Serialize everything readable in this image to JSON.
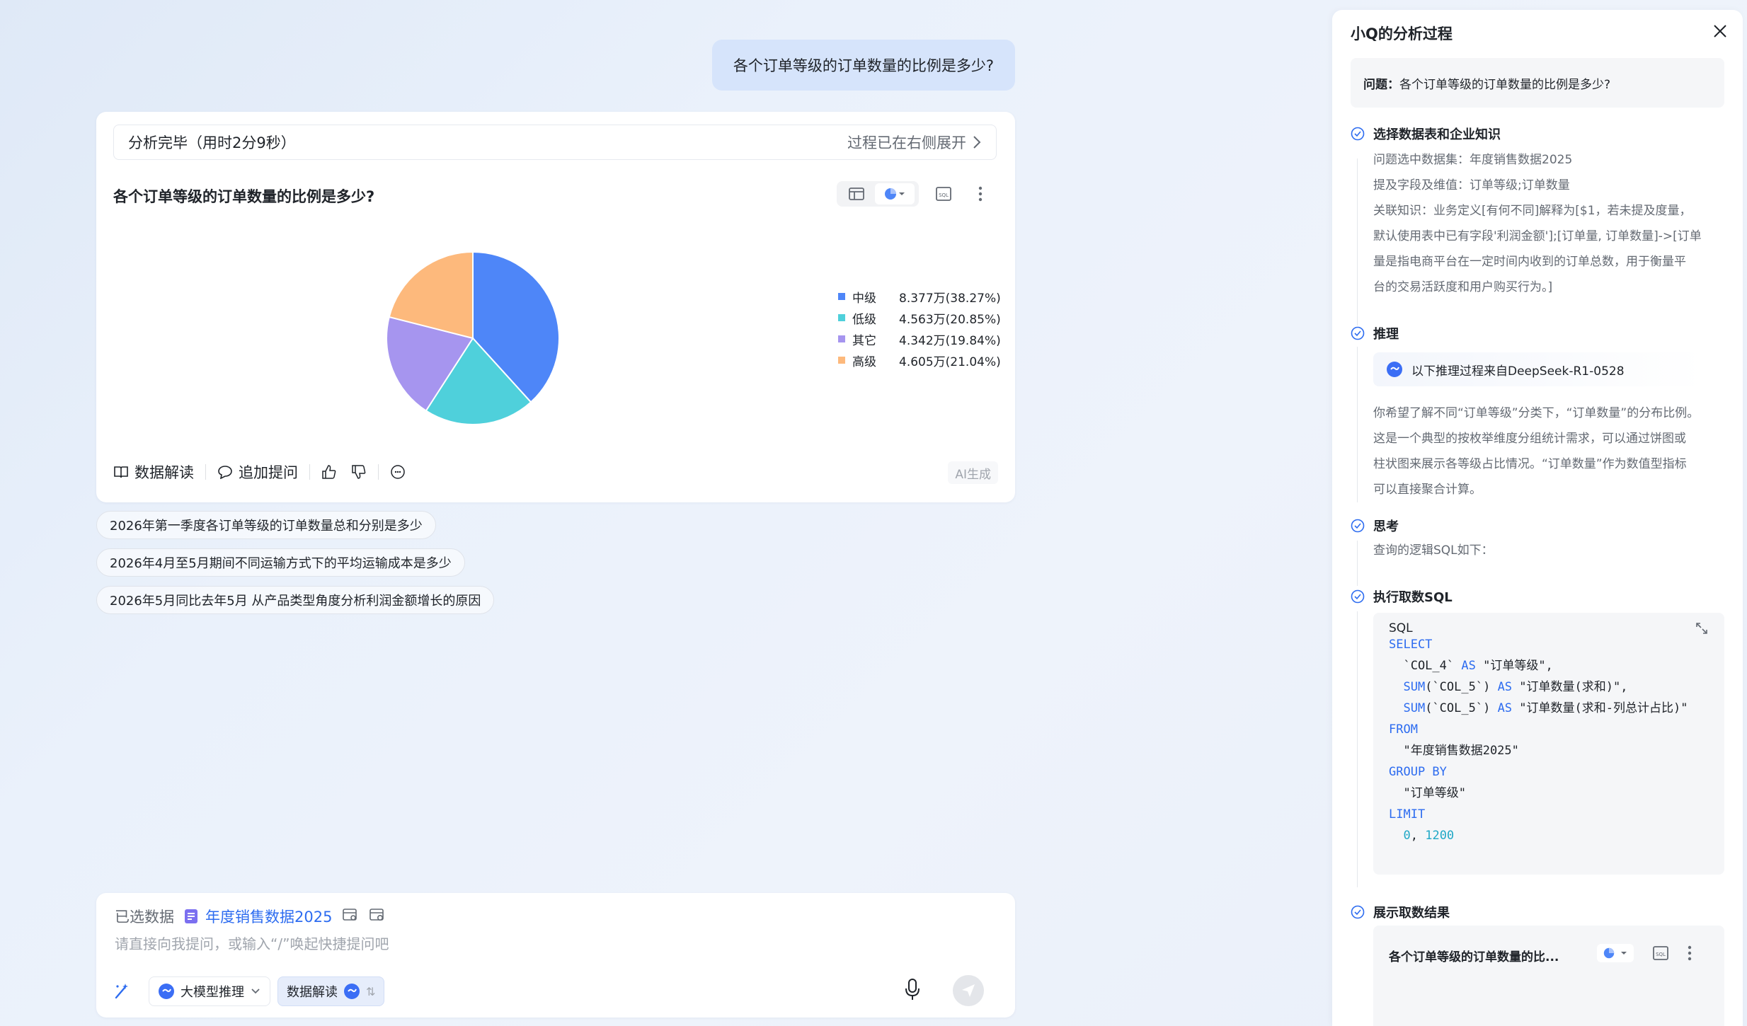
{
  "chat": {
    "user_question": "各个订单等级的订单数量的比例是多少?",
    "status_text": "分析完毕（用时2分9秒）",
    "process_hint": "过程已在右侧展开",
    "answer_title": "各个订单等级的订单数量的比例是多少?",
    "actions": {
      "interpret": "数据解读",
      "followup": "追加提问"
    },
    "ai_tag": "AI生成",
    "suggestions": [
      "2026年第一季度各订单等级的订单数量总和分别是多少",
      "2026年4月至5月期间不同运输方式下的平均运输成本是多少",
      "2026年5月同比去年5月 从产品类型角度分析利润金额增长的原因"
    ]
  },
  "chart_data": {
    "type": "pie",
    "slices": [
      {
        "name": "中级",
        "value": 8.377,
        "label": "8.377万(38.27%)",
        "percent": 38.27,
        "color": "#4e86f8"
      },
      {
        "name": "低级",
        "value": 4.563,
        "label": "4.563万(20.85%)",
        "percent": 20.85,
        "color": "#4fd0db"
      },
      {
        "name": "其它",
        "value": 4.342,
        "label": "4.342万(19.84%)",
        "percent": 19.84,
        "color": "#a695ef"
      },
      {
        "name": "高级",
        "value": 4.605,
        "label": "4.605万(21.04%)",
        "percent": 21.04,
        "color": "#fdb97c"
      }
    ],
    "legend_position": "right"
  },
  "input": {
    "selected_label": "已选数据",
    "dataset_name": "年度销售数据2025",
    "placeholder": "请直接向我提问，或输入“/”唤起快捷提问吧",
    "model_label": "大模型推理",
    "mode_label": "数据解读",
    "mode_suffix": "⇅"
  },
  "panel": {
    "title": "小Q的分析过程",
    "question_prefix": "问题：",
    "question": "各个订单等级的订单数量的比例是多少?",
    "steps": {
      "select": {
        "title": "选择数据表和企业知识",
        "lines": [
          "问题选中数据集：年度销售数据2025",
          "提及字段及维值：订单等级;订单数量",
          "关联知识：业务定义[有何不同]解释为[$1，若未提及度量，",
          "默认使用表中已有字段'利润金额'];[订单量, 订单数量]->[订单",
          "量是指电商平台在一定时间内收到的订单总数，用于衡量平",
          "台的交易活跃度和用户购买行为。]"
        ]
      },
      "reason": {
        "title": "推理",
        "source": "以下推理过程来自DeepSeek-R1-0528",
        "lines": [
          "你希望了解不同“订单等级”分类下，“订单数量”的分布比例。",
          "这是一个典型的按枚举维度分组统计需求，可以通过饼图或",
          "柱状图来展示各等级占比情况。“订单数量”作为数值型指标",
          "可以直接聚合计算。"
        ]
      },
      "think": {
        "title": "思考",
        "text": "查询的逻辑SQL如下："
      },
      "sql": {
        "title": "执行取数SQL",
        "label": "SQL"
      },
      "result": {
        "title": "展示取数结果",
        "chart_title": "各个订单等级的订单数量的比..."
      }
    }
  }
}
